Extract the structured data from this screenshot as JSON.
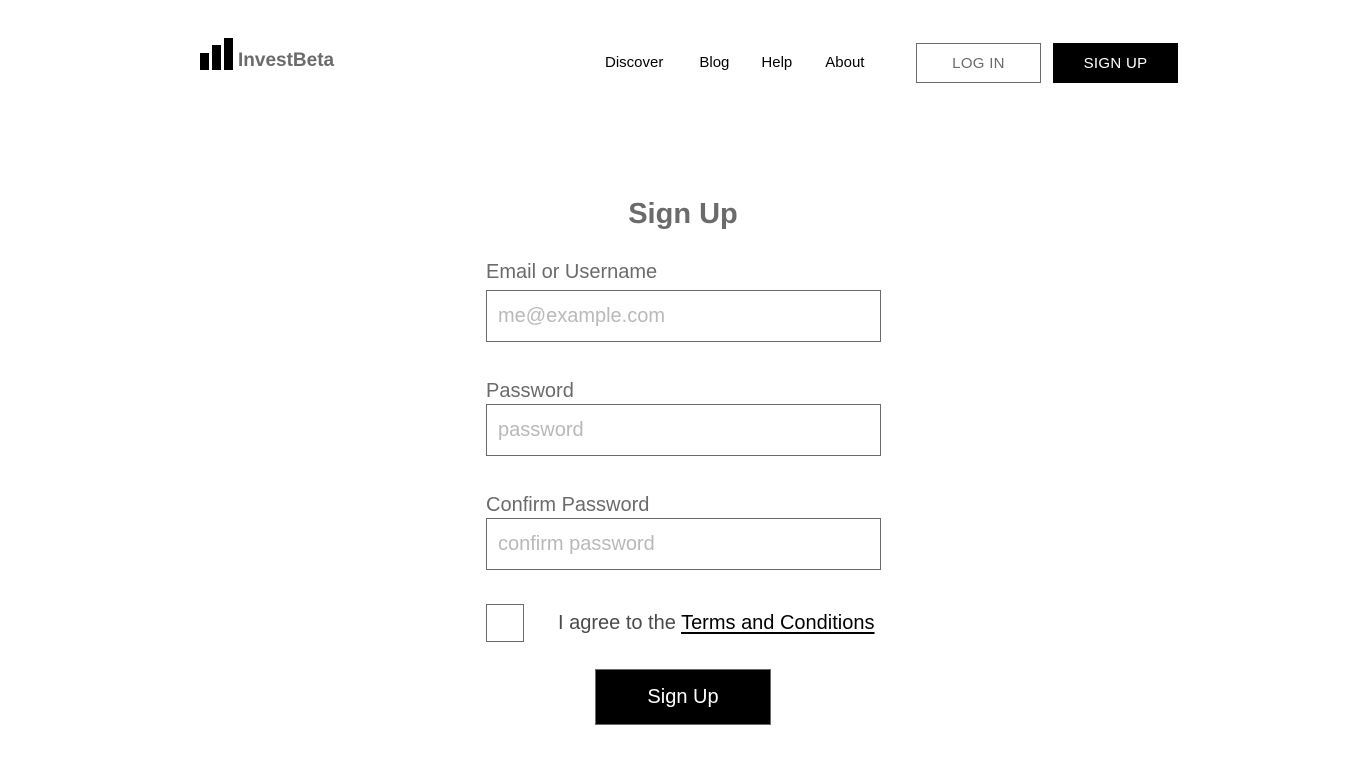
{
  "header": {
    "logo_text": "InvestBeta",
    "nav": {
      "discover": "Discover",
      "blog": "Blog",
      "help": "Help",
      "about": "About"
    },
    "login_label": "LOG IN",
    "signup_label": "SIGN UP"
  },
  "form": {
    "title": "Sign Up",
    "email": {
      "label": "Email or Username",
      "placeholder": "me@example.com",
      "value": ""
    },
    "password": {
      "label": "Password",
      "placeholder": "password",
      "value": ""
    },
    "confirm": {
      "label": "Confirm Password",
      "placeholder": "confirm password",
      "value": ""
    },
    "agree": {
      "prefix": "I agree to the ",
      "link": "Terms and Conditions",
      "checked": false
    },
    "submit_label": "Sign Up"
  },
  "colors": {
    "primary": "#000000",
    "text_muted": "#6b6b6b",
    "placeholder": "#b9b9b9",
    "background": "#ffffff"
  },
  "icons": {
    "logo": "bar-chart-logo-icon"
  }
}
